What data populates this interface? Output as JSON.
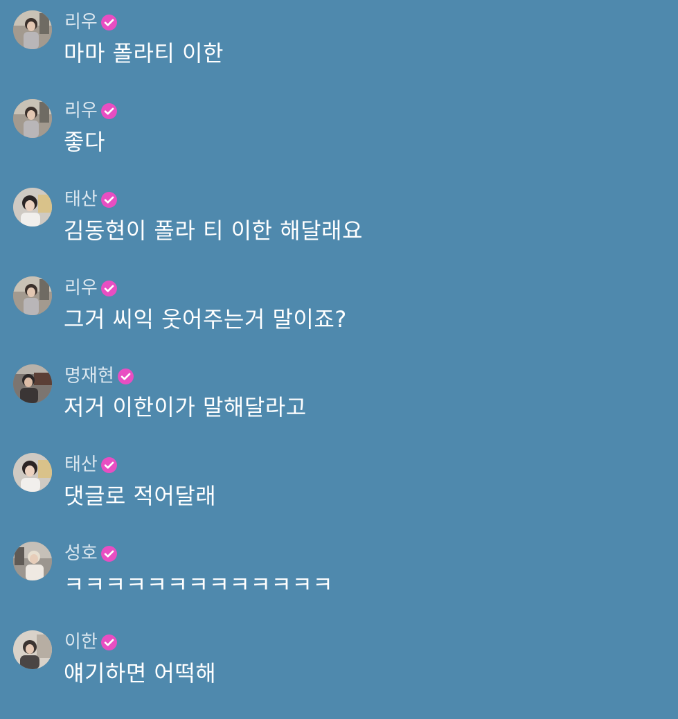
{
  "chat": {
    "messages": [
      {
        "user": "리우",
        "verified_icon": "verified-badge-icon",
        "avatar": "riu",
        "text": "마마 폴라티 이한"
      },
      {
        "user": "리우",
        "verified_icon": "verified-badge-icon",
        "avatar": "riu",
        "text": "좋다"
      },
      {
        "user": "태산",
        "verified_icon": "verified-badge-icon",
        "avatar": "taesan",
        "text": "김동현이 폴라 티 이한 해달래요"
      },
      {
        "user": "리우",
        "verified_icon": "verified-badge-icon",
        "avatar": "riu",
        "text": "그거 씨익 웃어주는거 말이죠?"
      },
      {
        "user": "명재현",
        "verified_icon": "verified-badge-icon",
        "avatar": "myungjaehyun",
        "text": "저거 이한이가 말해달라고"
      },
      {
        "user": "태산",
        "verified_icon": "verified-badge-icon",
        "avatar": "taesan",
        "text": "댓글로 적어달래"
      },
      {
        "user": "성호",
        "verified_icon": "verified-badge-icon",
        "avatar": "sungho",
        "text": "ㅋㅋㅋㅋㅋㅋㅋㅋㅋㅋㅋㅋㅋ"
      },
      {
        "user": "이한",
        "verified_icon": "verified-badge-icon",
        "avatar": "leehan",
        "text": "얘기하면 어떡해"
      }
    ]
  },
  "colors": {
    "background": "#4f89ad",
    "name_text": "#dbe7ef",
    "message_text": "#ffffff",
    "verified_badge": "#e84ec2"
  }
}
